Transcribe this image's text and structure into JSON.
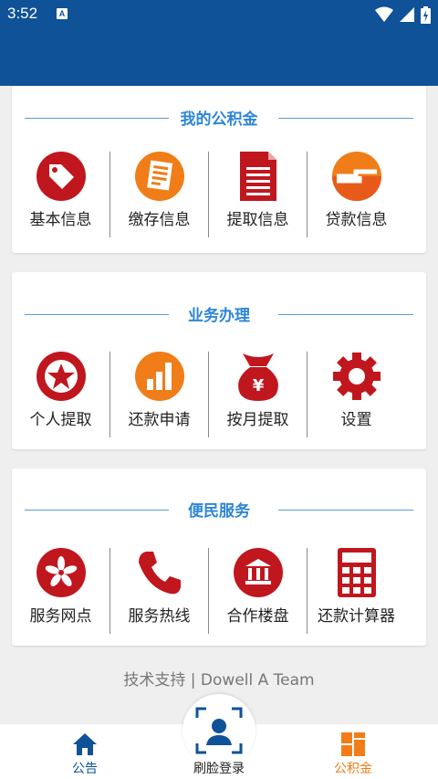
{
  "status_bar": {
    "time": "3:52",
    "notification_badge": "A",
    "icons": [
      "wifi-icon",
      "signal-icon",
      "battery-icon"
    ]
  },
  "colors": {
    "header_blue": "#0f5297",
    "accent_blue": "#2e86d6",
    "icon_red": "#c0171f",
    "icon_orange": "#f07d18",
    "active_tab": "#f07d18"
  },
  "sections": [
    {
      "title": "我的公积金",
      "items": [
        {
          "label": "基本信息",
          "icon": "tag-icon"
        },
        {
          "label": "缴存信息",
          "icon": "document-icon"
        },
        {
          "label": "提取信息",
          "icon": "file-icon"
        },
        {
          "label": "贷款信息",
          "icon": "loan-icon"
        }
      ]
    },
    {
      "title": "业务办理",
      "items": [
        {
          "label": "个人提取",
          "icon": "star-icon"
        },
        {
          "label": "还款申请",
          "icon": "bar-chart-icon"
        },
        {
          "label": "按月提取",
          "icon": "money-bag-icon"
        },
        {
          "label": "设置",
          "icon": "gear-icon"
        }
      ]
    },
    {
      "title": "便民服务",
      "items": [
        {
          "label": "服务网点",
          "icon": "flower-icon"
        },
        {
          "label": "服务热线",
          "icon": "phone-icon"
        },
        {
          "label": "合作楼盘",
          "icon": "building-icon"
        },
        {
          "label": "还款计算器",
          "icon": "calculator-icon"
        }
      ]
    }
  ],
  "footer": {
    "text": "技术支持 | Dowell A Team"
  },
  "bottom_nav": {
    "items": [
      {
        "label": "公告",
        "icon": "home-icon"
      },
      {
        "label": "刷脸登录",
        "icon": "face-scan-icon"
      },
      {
        "label": "公积金",
        "icon": "grid-icon",
        "active": true
      }
    ]
  }
}
